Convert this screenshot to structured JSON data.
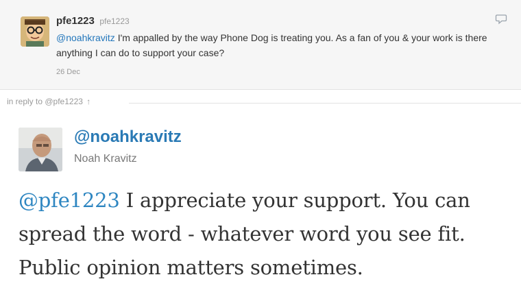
{
  "parent_tweet": {
    "name": "pfe1223",
    "handle": "pfe1223",
    "mention": "@noahkravitz",
    "text": " I'm appalled by the way Phone Dog is treating you. As a fan of you & your work is there anything I can do to support your case?",
    "date": "26 Dec"
  },
  "in_reply_to": {
    "label": "in reply to @pfe1223",
    "arrow": "↑"
  },
  "main_tweet": {
    "handle": "@noahkravitz",
    "name": "Noah Kravitz",
    "mention": "@pfe1223",
    "text": " I appreciate your support. You can spread the word - whatever word you see fit. Public opinion matters sometimes."
  },
  "colors": {
    "link": "#2a7ab5",
    "muted": "#999999",
    "text": "#333333"
  },
  "icons": {
    "parent_avatar": "cartoon-avatar-icon",
    "main_avatar": "user-photo-avatar",
    "reply_icon": "speech-bubble-icon"
  }
}
